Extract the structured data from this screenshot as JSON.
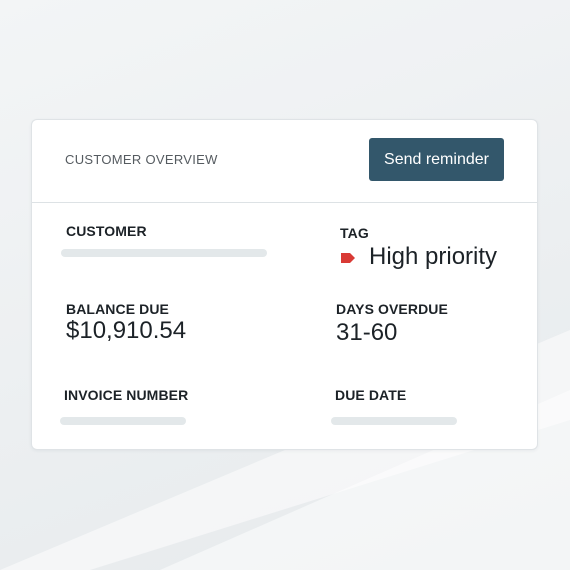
{
  "card": {
    "title": "CUSTOMER OVERVIEW",
    "send_button": "Send reminder"
  },
  "fields": {
    "customer": {
      "label": "CUSTOMER"
    },
    "tag": {
      "label": "TAG",
      "value": "High priority",
      "icon": "tag-icon",
      "color": "#d93a35"
    },
    "balance_due": {
      "label": "BALANCE DUE",
      "value": "$10,910.54"
    },
    "days_overdue": {
      "label": "DAYS OVERDUE",
      "value": "31-60"
    },
    "invoice_number": {
      "label": "INVOICE NUMBER"
    },
    "due_date": {
      "label": "DUE DATE"
    }
  },
  "colors": {
    "button": "#33576b",
    "placeholder": "#e3e8ea",
    "tag": "#d93a35"
  }
}
